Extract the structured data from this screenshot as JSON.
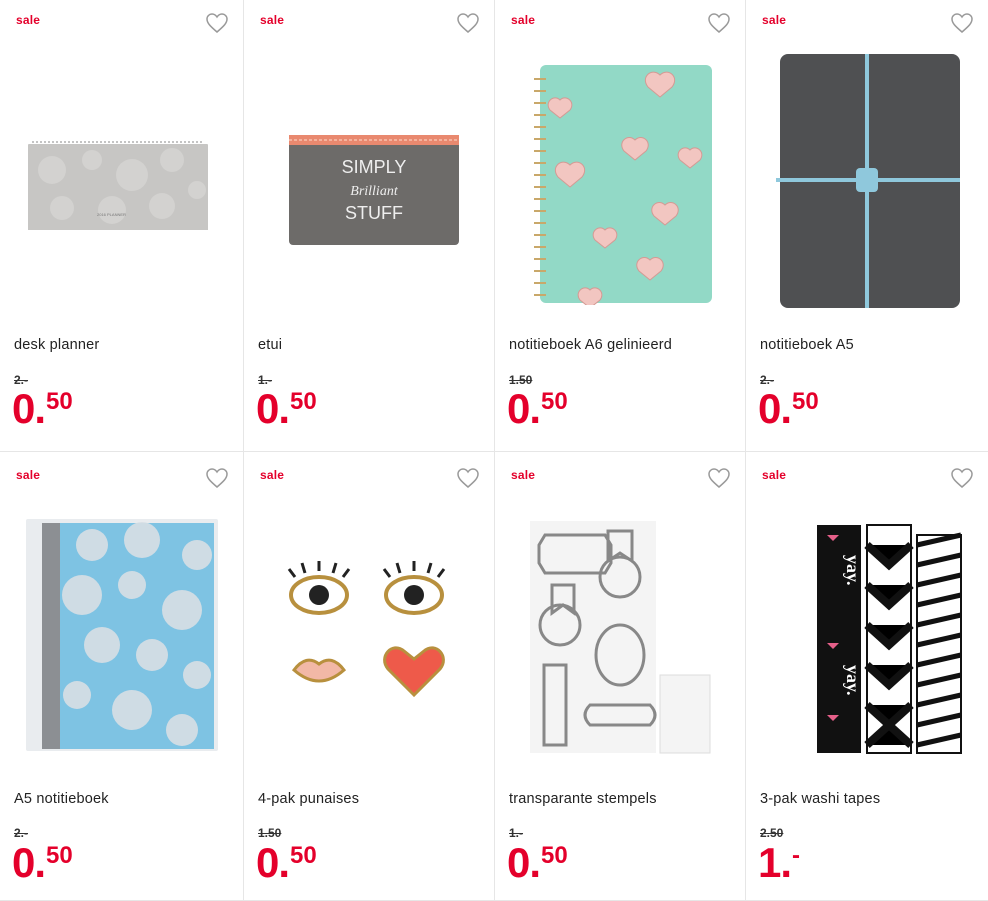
{
  "products": [
    {
      "badge": "sale",
      "name": "desk planner",
      "old_price": "2.-",
      "price_int": "0.",
      "price_dec": "50"
    },
    {
      "badge": "sale",
      "name": "etui",
      "old_price": "1.-",
      "price_int": "0.",
      "price_dec": "50",
      "image_text": [
        "SIMPLY",
        "Brilliant",
        "STUFF"
      ]
    },
    {
      "badge": "sale",
      "name": "notitieboek A6 gelinieerd",
      "old_price": "1.50",
      "price_int": "0.",
      "price_dec": "50"
    },
    {
      "badge": "sale",
      "name": "notitieboek A5",
      "old_price": "2.-",
      "price_int": "0.",
      "price_dec": "50"
    },
    {
      "badge": "sale",
      "name": "A5 notitieboek",
      "old_price": "2.-",
      "price_int": "0.",
      "price_dec": "50"
    },
    {
      "badge": "sale",
      "name": "4-pak punaises",
      "old_price": "1.50",
      "price_int": "0.",
      "price_dec": "50"
    },
    {
      "badge": "sale",
      "name": "transparante stempels",
      "old_price": "1.-",
      "price_int": "0.",
      "price_dec": "50"
    },
    {
      "badge": "sale",
      "name": "3-pak washi tapes",
      "old_price": "2.50",
      "price_int": "1.",
      "price_dec": "-",
      "image_text": [
        "yay.",
        "yay."
      ]
    }
  ],
  "colors": {
    "accent": "#e4002b",
    "border": "#e6e6e6"
  },
  "icons": {
    "favorite": "heart-outline-icon"
  }
}
